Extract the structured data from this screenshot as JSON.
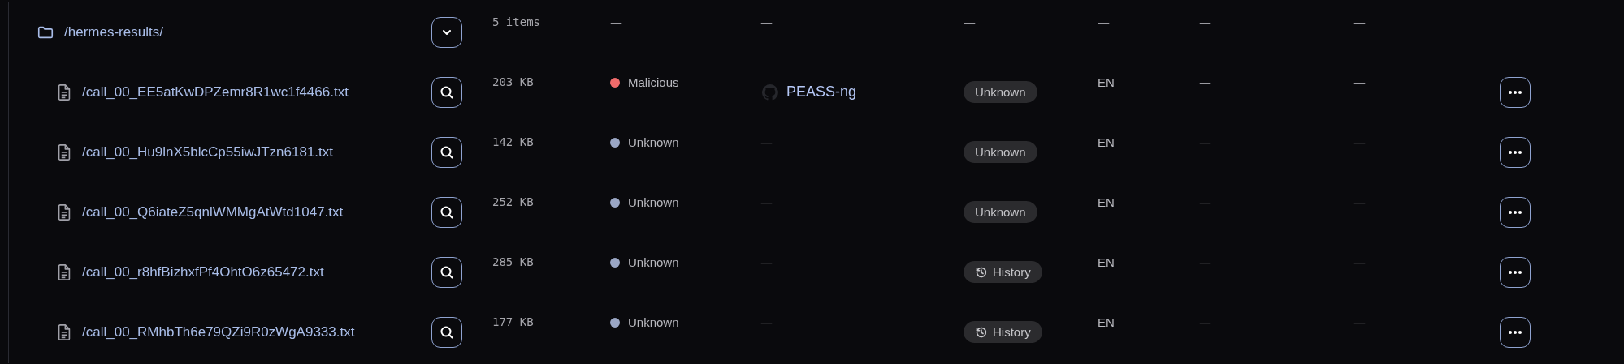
{
  "rows": [
    {
      "kind": "folder",
      "name": "/hermes-results/",
      "size": "5 items",
      "status": {
        "label": "—"
      },
      "repo": {
        "kind": "none",
        "label": "—"
      },
      "tag": {
        "kind": "none",
        "label": "—"
      },
      "language": "—",
      "column_7": "—",
      "column_8": "—"
    },
    {
      "kind": "file",
      "name": "/call_00_EE5atKwDPZemr8R1wc1f4466.txt",
      "size": "203 KB",
      "status": {
        "label": "Malicious",
        "color": "#f06b6b"
      },
      "repo": {
        "kind": "github",
        "label": "PEASS-ng"
      },
      "tag": {
        "kind": "plain",
        "label": "Unknown"
      },
      "language": "EN",
      "column_7": "—",
      "column_8": "—"
    },
    {
      "kind": "file",
      "name": "/call_00_Hu9lnX5blcCp55iwJTzn6181.txt",
      "size": "142 KB",
      "status": {
        "label": "Unknown",
        "color": "#9aa6c4"
      },
      "repo": {
        "kind": "none",
        "label": "—"
      },
      "tag": {
        "kind": "plain",
        "label": "Unknown"
      },
      "language": "EN",
      "column_7": "—",
      "column_8": "—"
    },
    {
      "kind": "file",
      "name": "/call_00_Q6iateZ5qnlWMMgAtWtd1047.txt",
      "size": "252 KB",
      "status": {
        "label": "Unknown",
        "color": "#9aa6c4"
      },
      "repo": {
        "kind": "none",
        "label": "—"
      },
      "tag": {
        "kind": "plain",
        "label": "Unknown"
      },
      "language": "EN",
      "column_7": "—",
      "column_8": "—"
    },
    {
      "kind": "file",
      "name": "/call_00_r8hfBizhxfPf4OhtO6z65472.txt",
      "size": "285 KB",
      "status": {
        "label": "Unknown",
        "color": "#9aa6c4"
      },
      "repo": {
        "kind": "none",
        "label": "—"
      },
      "tag": {
        "kind": "history",
        "label": "History"
      },
      "language": "EN",
      "column_7": "—",
      "column_8": "—"
    },
    {
      "kind": "file",
      "name": "/call_00_RMhbTh6e79QZi9R0zWgA9333.txt",
      "size": "177 KB",
      "status": {
        "label": "Unknown",
        "color": "#9aa6c4"
      },
      "repo": {
        "kind": "none",
        "label": "—"
      },
      "tag": {
        "kind": "history",
        "label": "History"
      },
      "language": "EN",
      "column_7": "—",
      "column_8": "—"
    }
  ]
}
